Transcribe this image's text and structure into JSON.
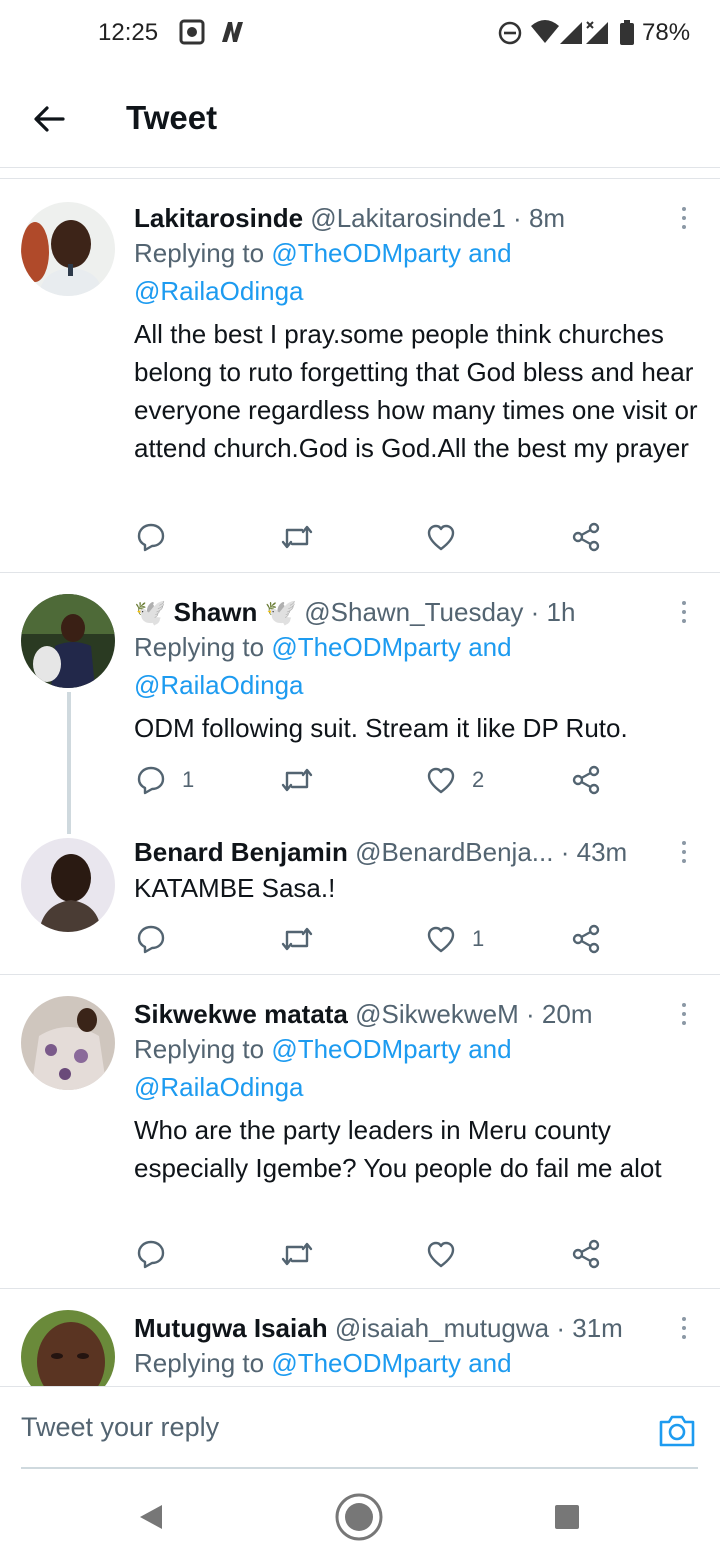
{
  "status_bar": {
    "time": "12:25",
    "battery": "78%",
    "icons": [
      "photo-notification-icon",
      "n-notification-icon",
      "do-not-disturb-icon",
      "wifi-icon",
      "signal-icon",
      "signal-no-data-icon",
      "battery-icon"
    ]
  },
  "header": {
    "title": "Tweet",
    "back_icon": "arrow-left-icon"
  },
  "tweets": [
    {
      "name": "Lakitarosinde",
      "handle": "@Lakitarosinde1",
      "dot": "·",
      "time": "8m",
      "replying_prefix": "Replying to",
      "mention1": "@TheODMparty",
      "mention_join": "and",
      "mention2": "@RailaOdinga",
      "body": "All the best I pray.some people think churches belong to ruto forgetting that God bless and hear everyone regardless how many times one visit or attend church.God is God.All the best my prayer",
      "replies": "",
      "retweets": "",
      "likes": ""
    },
    {
      "name": "Shawn",
      "name_emoji": "🕊️",
      "handle": "@Shawn_Tuesday",
      "dot": "·",
      "time": "1h",
      "replying_prefix": "Replying to",
      "mention1": "@TheODMparty",
      "mention_join": "and",
      "mention2": "@RailaOdinga",
      "body": "ODM following suit. Stream it like DP Ruto.",
      "replies": "1",
      "retweets": "",
      "likes": "2"
    },
    {
      "name": "Benard Benjamin",
      "handle": "@BenardBenja...",
      "dot": "·",
      "time": "43m",
      "body": "KATAMBE Sasa.!",
      "replies": "",
      "retweets": "",
      "likes": "1"
    },
    {
      "name": "Sikwekwe matata",
      "handle": "@SikwekweM",
      "dot": "·",
      "time": "20m",
      "replying_prefix": "Replying to",
      "mention1": "@TheODMparty",
      "mention_join": "and",
      "mention2": "@RailaOdinga",
      "body": "Who are the party leaders in Meru county especially Igembe? You people do fail me alot",
      "replies": "",
      "retweets": "",
      "likes": ""
    },
    {
      "name": "Mutugwa Isaiah",
      "handle": "@isaiah_mutugwa",
      "dot": "·",
      "time": "31m",
      "replying_prefix": "Replying to",
      "mention1": "@TheODMparty",
      "mention_join": "and"
    }
  ],
  "composer": {
    "placeholder": "Tweet your reply",
    "camera_icon": "camera-icon"
  },
  "colors": {
    "accent": "#1d9bf0",
    "text_primary": "#0f1419",
    "text_secondary": "#536471",
    "divider": "#e1e4e8"
  }
}
